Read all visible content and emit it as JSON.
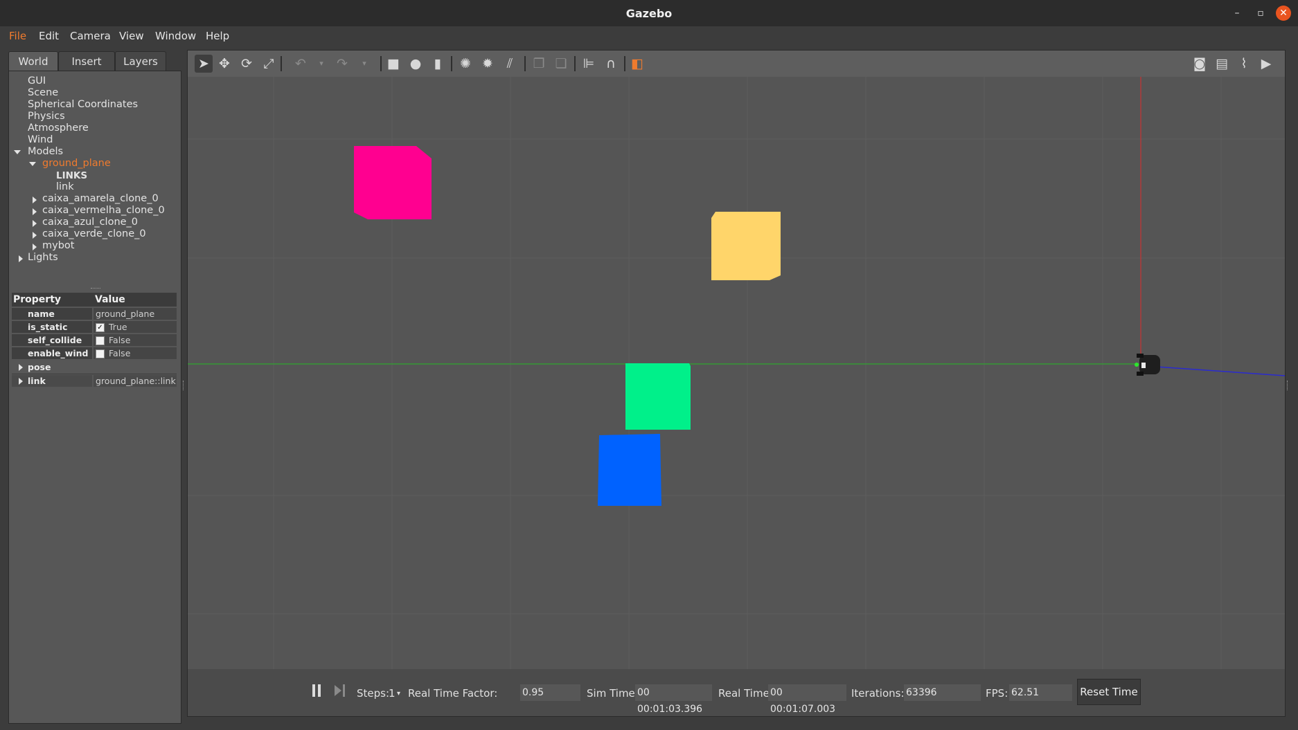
{
  "window": {
    "title": "Gazebo",
    "minimize": "–",
    "restore": "▫",
    "close": "✕"
  },
  "menu": [
    "File",
    "Edit",
    "Camera",
    "View",
    "Window",
    "Help"
  ],
  "left_tabs": [
    "World",
    "Insert",
    "Layers"
  ],
  "tree": {
    "items": [
      "GUI",
      "Scene",
      "Spherical Coordinates",
      "Physics",
      "Atmosphere",
      "Wind",
      "Models"
    ],
    "models": {
      "selected": "ground_plane",
      "ground_plane_children": [
        "LINKS",
        "link"
      ],
      "others": [
        "caixa_amarela_clone_0",
        "caixa_vermelha_clone_0",
        "caixa_azul_clone_0",
        "caixa_verde_clone_0",
        "mybot"
      ]
    },
    "lights": "Lights"
  },
  "properties": {
    "header": {
      "property": "Property",
      "value": "Value"
    },
    "rows": [
      {
        "key": "name",
        "value": "ground_plane"
      },
      {
        "key": "is_static",
        "value": "True",
        "checked": true
      },
      {
        "key": "self_collide",
        "value": "False",
        "checked": false
      },
      {
        "key": "enable_wind",
        "value": "False",
        "checked": false
      }
    ],
    "pose": "pose",
    "link": {
      "key": "link",
      "value": "ground_plane::link"
    }
  },
  "toolbar": {
    "tools": [
      "select-mode",
      "translate-mode",
      "rotate-mode",
      "scale-mode",
      "undo",
      "redo",
      "box",
      "sphere",
      "cylinder",
      "point-light",
      "spot-light",
      "directional-light",
      "copy",
      "paste",
      "align",
      "snap",
      "view-angle"
    ],
    "right": [
      "screenshot",
      "log",
      "plot",
      "record-video"
    ]
  },
  "scene_objects": [
    {
      "name": "caixa_vermelha_clone_0",
      "color": "#ff0090"
    },
    {
      "name": "caixa_amarela_clone_0",
      "color": "#ffd56a"
    },
    {
      "name": "caixa_verde_clone_0",
      "color": "#00f08a"
    },
    {
      "name": "caixa_azul_clone_0",
      "color": "#0062ff"
    }
  ],
  "bottom": {
    "steps_label": "Steps:",
    "steps_value": "1",
    "rtf_label": "Real Time Factor:",
    "rtf_value": "0.95",
    "sim_label": "Sim Time:",
    "sim_value": "00 00:01:03.396",
    "real_label": "Real Time:",
    "real_value": "00 00:01:07.003",
    "iter_label": "Iterations:",
    "iter_value": "63396",
    "fps_label": "FPS:",
    "fps_value": "62.51",
    "reset_label": "Reset Time"
  },
  "colors": {
    "accent": "#f07b2e",
    "axis_x": "#c83232",
    "axis_y": "#2ea62e",
    "axis_z": "#2a2ad0"
  }
}
